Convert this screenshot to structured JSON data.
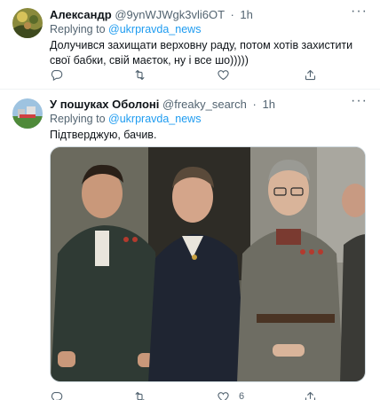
{
  "tweets": [
    {
      "name": "Александр",
      "handle": "@9ynWJWgk3vli6OT",
      "separator": "·",
      "time": "1h",
      "more": "···",
      "replying_prefix": "Replying to",
      "replying_to": "@ukrpravda_news",
      "text": "Долучився захищати верховну раду,  потом хотів захистити свої бабки, свій маєток,  ну і все шо)))))",
      "likes": ""
    },
    {
      "name": "У пошуках Оболоні",
      "handle": "@freaky_search",
      "separator": "·",
      "time": "1h",
      "more": "···",
      "replying_prefix": "Replying to",
      "replying_to": "@ukrpravda_news",
      "text": "Підтверджую, бачив.",
      "likes": "6"
    }
  ],
  "icons": {
    "more": "more-icon",
    "reply": "reply-icon",
    "retweet": "retweet-icon",
    "like": "heart-icon",
    "share": "share-icon"
  },
  "colors": {
    "accent": "#1d9bf0",
    "muted": "#536471",
    "text": "#0f1419",
    "border": "#eff3f4"
  }
}
